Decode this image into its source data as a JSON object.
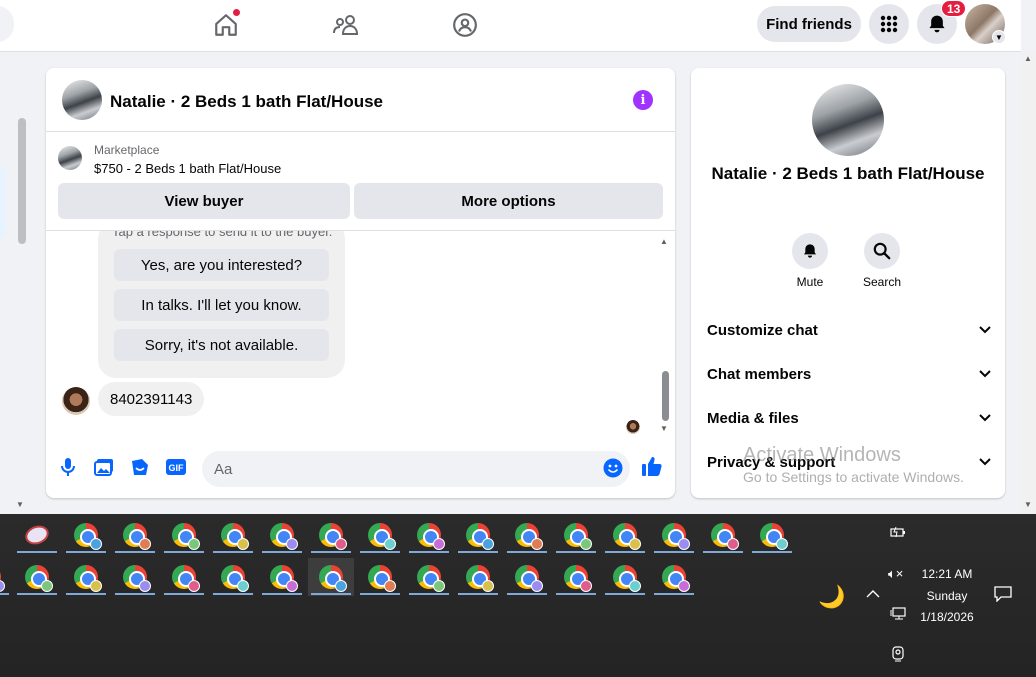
{
  "topbar": {
    "find_friends": "Find friends",
    "notif_count": "13"
  },
  "chat": {
    "title": "Natalie · 2 Beds 1 bath Flat/House",
    "marketplace_label": "Marketplace",
    "listing_price_title": "$750 - 2 Beds 1 bath Flat/House",
    "view_buyer": "View buyer",
    "more_options": "More options",
    "quick_hint": "Tap a response to send it to the buyer.",
    "quick_replies": [
      "Yes, are you interested?",
      "In talks. I'll let you know.",
      "Sorry, it's not available."
    ],
    "message": "8402391143",
    "input_placeholder": "Aa"
  },
  "info_panel": {
    "name": "Natalie · 2 Beds 1 bath Flat/House",
    "actions": [
      "Mute",
      "Search"
    ],
    "sections": [
      "Customize chat",
      "Chat members",
      "Media & files",
      "Privacy & support"
    ]
  },
  "watermark": {
    "line1": "Activate Windows",
    "line2": "Go to Settings to activate Windows."
  },
  "tray": {
    "time": "12:21 AM",
    "day": "Sunday",
    "date": "1/18/2026"
  },
  "colors": {
    "accent": "#0866ff",
    "info_purple": "#a033ff",
    "badge_red": "#e41e3f"
  }
}
